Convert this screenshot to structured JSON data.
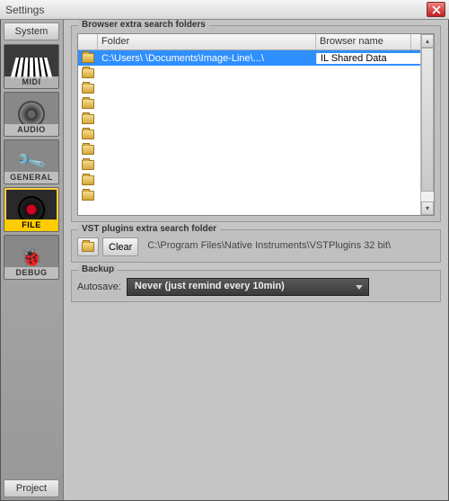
{
  "window": {
    "title": "Settings"
  },
  "sidebar": {
    "system_label": "System",
    "project_label": "Project",
    "tabs": [
      {
        "label": "MIDI"
      },
      {
        "label": "AUDIO"
      },
      {
        "label": "GENERAL"
      },
      {
        "label": "FILE"
      },
      {
        "label": "DEBUG"
      }
    ]
  },
  "browser_section": {
    "title": "Browser extra search folders",
    "columns": {
      "folder": "Folder",
      "name": "Browser name"
    },
    "rows": [
      {
        "folder": "C:\\Users\\            \\Documents\\Image-Line\\...\\",
        "name": "IL Shared Data",
        "selected": true
      },
      {
        "folder": "",
        "name": ""
      },
      {
        "folder": "",
        "name": ""
      },
      {
        "folder": "",
        "name": ""
      },
      {
        "folder": "",
        "name": ""
      },
      {
        "folder": "",
        "name": ""
      },
      {
        "folder": "",
        "name": ""
      },
      {
        "folder": "",
        "name": ""
      },
      {
        "folder": "",
        "name": ""
      },
      {
        "folder": "",
        "name": ""
      }
    ]
  },
  "vst_section": {
    "title": "VST plugins extra search folder",
    "clear_label": "Clear",
    "path": "C:\\Program Files\\Native Instruments\\VSTPlugins 32 bit\\"
  },
  "backup_section": {
    "title": "Backup",
    "autosave_label": "Autosave:",
    "autosave_value": "Never (just remind every 10min)"
  }
}
